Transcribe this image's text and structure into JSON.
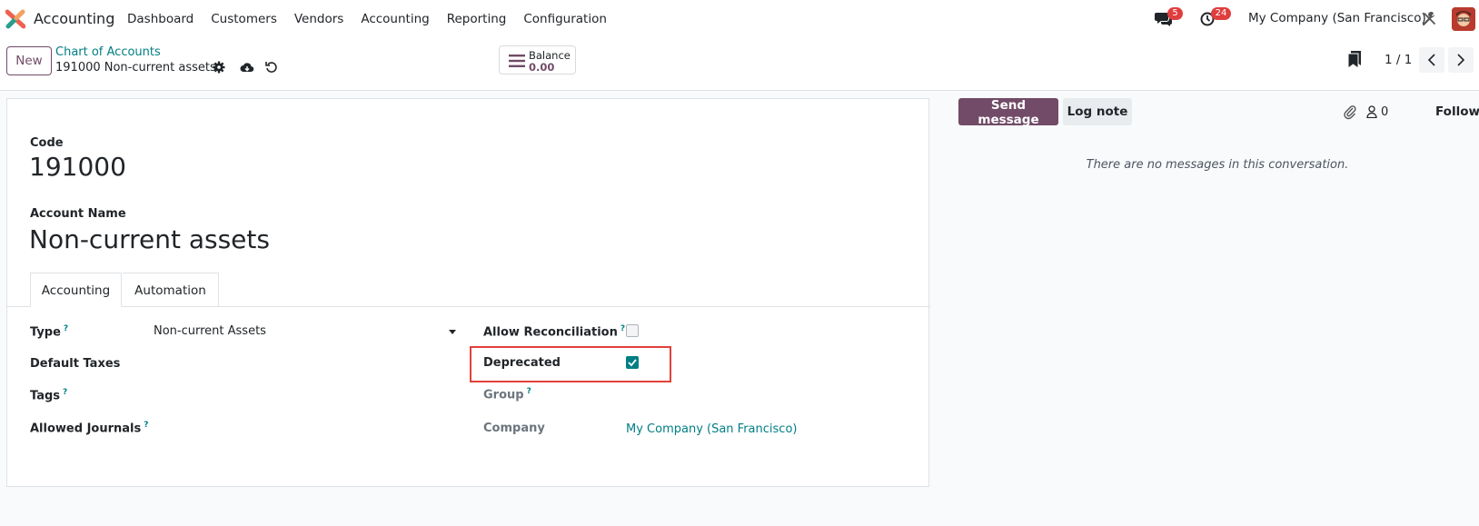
{
  "navbar": {
    "app_name": "Accounting",
    "menu": [
      "Dashboard",
      "Customers",
      "Vendors",
      "Accounting",
      "Reporting",
      "Configuration"
    ],
    "messages_count": "5",
    "activities_count": "24",
    "company": "My Company (San Francisco)"
  },
  "control": {
    "new_label": "New",
    "breadcrumb": "Chart of Accounts",
    "record_title": "191000 Non-current assets",
    "balance_label": "Balance",
    "balance_value": "0.00",
    "pager": "1 / 1"
  },
  "form": {
    "code_label": "Code",
    "code_value": "191000",
    "name_label": "Account Name",
    "name_value": "Non-current assets",
    "tabs": [
      "Accounting",
      "Automation"
    ],
    "fields": {
      "type_label": "Type",
      "type_value": "Non-current Assets",
      "default_taxes_label": "Default Taxes",
      "tags_label": "Tags",
      "allowed_journals_label": "Allowed Journals",
      "allow_reconciliation_label": "Allow Reconciliation",
      "allow_reconciliation": false,
      "deprecated_label": "Deprecated",
      "deprecated": true,
      "group_label": "Group",
      "company_label": "Company",
      "company_value": "My Company (San Francisco)"
    },
    "help_mark": "?"
  },
  "chatter": {
    "send_message": "Send message",
    "log_note": "Log note",
    "followers": "0",
    "follow": "Follow",
    "empty_text": "There are no messages in this conversation."
  },
  "colors": {
    "brand": "#714b67",
    "link": "#017e84",
    "badge": "#e03e3e",
    "highlight": "#e2413a"
  }
}
